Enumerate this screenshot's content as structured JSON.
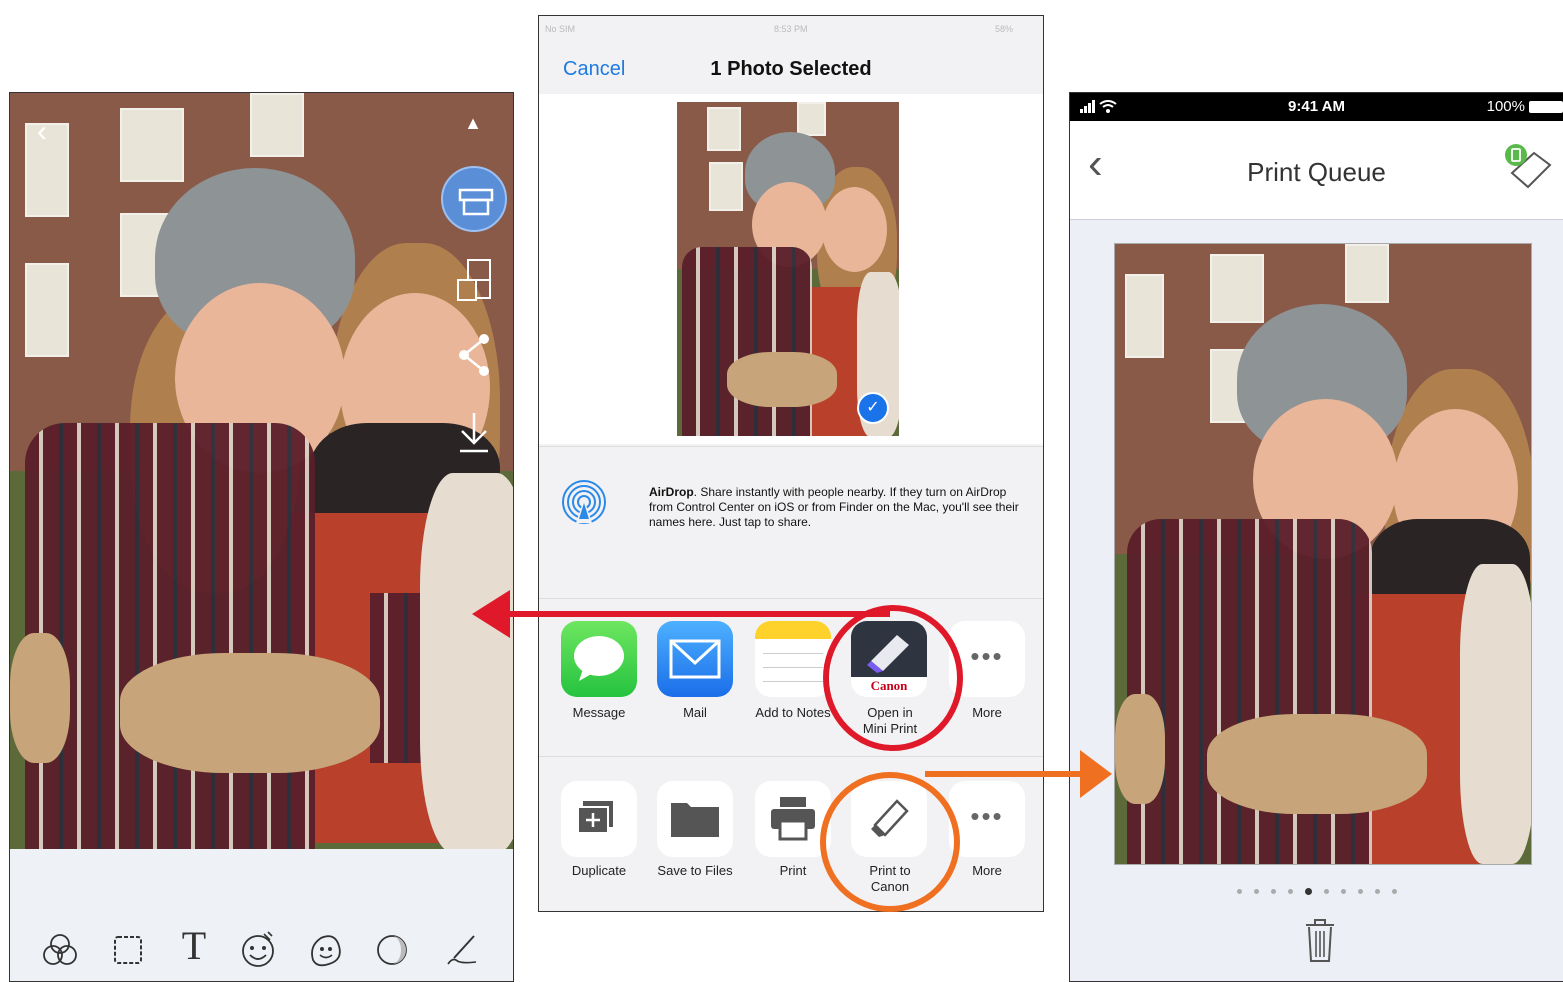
{
  "left_editor": {
    "tools": [
      "filter-icon",
      "frame-icon",
      "text-icon",
      "sticker-icon",
      "emoji-icon",
      "adjust-icon",
      "draw-icon"
    ]
  },
  "share_sheet": {
    "status_bar": {
      "carrier": "No SIM",
      "time": "8:53 PM",
      "battery": "58%"
    },
    "cancel": "Cancel",
    "title": "1 Photo Selected",
    "airdrop": {
      "title": "AirDrop",
      "text": ". Share instantly with people nearby. If they turn on AirDrop from Control Center on iOS or from Finder on the Mac, you'll see their names here. Just tap to share."
    },
    "apps": [
      {
        "label": "Message",
        "icon": "message-icon"
      },
      {
        "label": "Mail",
        "icon": "mail-icon"
      },
      {
        "label": "Add to Notes",
        "icon": "notes-icon"
      },
      {
        "label_line1": "Open in",
        "label_line2": "Mini Print",
        "brand": "Canon",
        "icon": "canon-mini-print-icon"
      },
      {
        "label": "More",
        "icon": "more-icon"
      }
    ],
    "actions": [
      {
        "label": "Duplicate",
        "icon": "duplicate-icon"
      },
      {
        "label": "Save to Files",
        "icon": "folder-icon"
      },
      {
        "label": "Print",
        "icon": "printer-icon"
      },
      {
        "label_line1": "Print to",
        "label_line2": "Canon",
        "icon": "print-to-canon-icon"
      },
      {
        "label": "More",
        "icon": "more-icon"
      }
    ]
  },
  "print_queue": {
    "status_bar": {
      "time": "9:41 AM",
      "battery": "100%"
    },
    "title": "Print Queue",
    "page_dots": 10,
    "active_dot": 5
  },
  "colors": {
    "highlight_red": "#e0192a",
    "highlight_orange": "#f07022",
    "ios_blue": "#1a73e8"
  }
}
